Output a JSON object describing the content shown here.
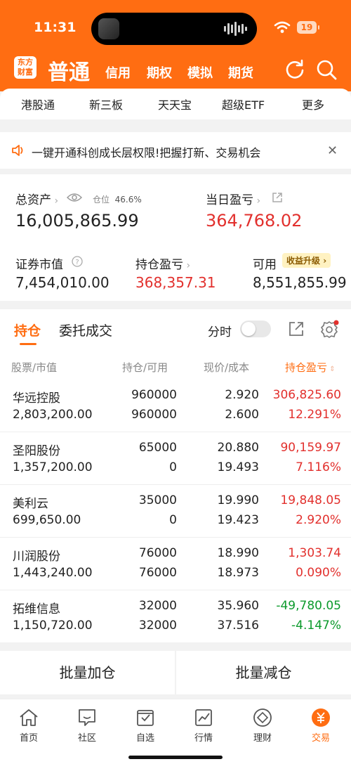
{
  "status": {
    "time": "11:31",
    "battery": "19"
  },
  "header": {
    "logo": "东方财富",
    "active_tab": "普通",
    "tabs": [
      "信用",
      "期权",
      "模拟",
      "期货"
    ]
  },
  "quickbar": [
    "港股通",
    "新三板",
    "天天宝",
    "超级ETF",
    "更多"
  ],
  "notice": {
    "text": "一键开通科创成长层权限!把握打新、交易机会"
  },
  "assets": {
    "total_label": "总资产",
    "position_ratio_label": "仓位",
    "position_ratio": "46.6%",
    "total_value": "16,005,865.99",
    "daily_pl_label": "当日盈亏",
    "daily_pl_value": "364,768.02",
    "market_value_label": "证券市值",
    "market_value": "7,454,010.00",
    "holding_pl_label": "持仓盈亏",
    "holding_pl_value": "368,357.31",
    "available_label": "可用",
    "available_value": "8,551,855.99",
    "upgrade_label": "收益升级"
  },
  "positions": {
    "tabs": [
      "持仓",
      "委托成交"
    ],
    "timeshare_label": "分时",
    "columns": [
      "股票/市值",
      "持仓/可用",
      "现价/成本",
      "持仓盈亏"
    ],
    "rows": [
      {
        "name": "华远控股",
        "mv": "2,803,200.00",
        "qty": "960000",
        "avail": "960000",
        "price": "2.920",
        "cost": "2.600",
        "pl": "306,825.60",
        "pl_pct": "12.291%",
        "up": true
      },
      {
        "name": "圣阳股份",
        "mv": "1,357,200.00",
        "qty": "65000",
        "avail": "0",
        "price": "20.880",
        "cost": "19.493",
        "pl": "90,159.97",
        "pl_pct": "7.116%",
        "up": true
      },
      {
        "name": "美利云",
        "mv": "699,650.00",
        "qty": "35000",
        "avail": "0",
        "price": "19.990",
        "cost": "19.423",
        "pl": "19,848.05",
        "pl_pct": "2.920%",
        "up": true
      },
      {
        "name": "川润股份",
        "mv": "1,443,240.00",
        "qty": "76000",
        "avail": "76000",
        "price": "18.990",
        "cost": "18.973",
        "pl": "1,303.74",
        "pl_pct": "0.090%",
        "up": true
      },
      {
        "name": "拓维信息",
        "mv": "1,150,720.00",
        "qty": "32000",
        "avail": "32000",
        "price": "35.960",
        "cost": "37.516",
        "pl": "-49,780.05",
        "pl_pct": "-4.147%",
        "up": false
      }
    ]
  },
  "batch": {
    "add": "批量加仓",
    "reduce": "批量减仓"
  },
  "nav": [
    "首页",
    "社区",
    "自选",
    "行情",
    "理财",
    "交易"
  ],
  "colors": {
    "brand": "#ff6d12",
    "up": "#e2302d",
    "down": "#0c9a2c"
  }
}
